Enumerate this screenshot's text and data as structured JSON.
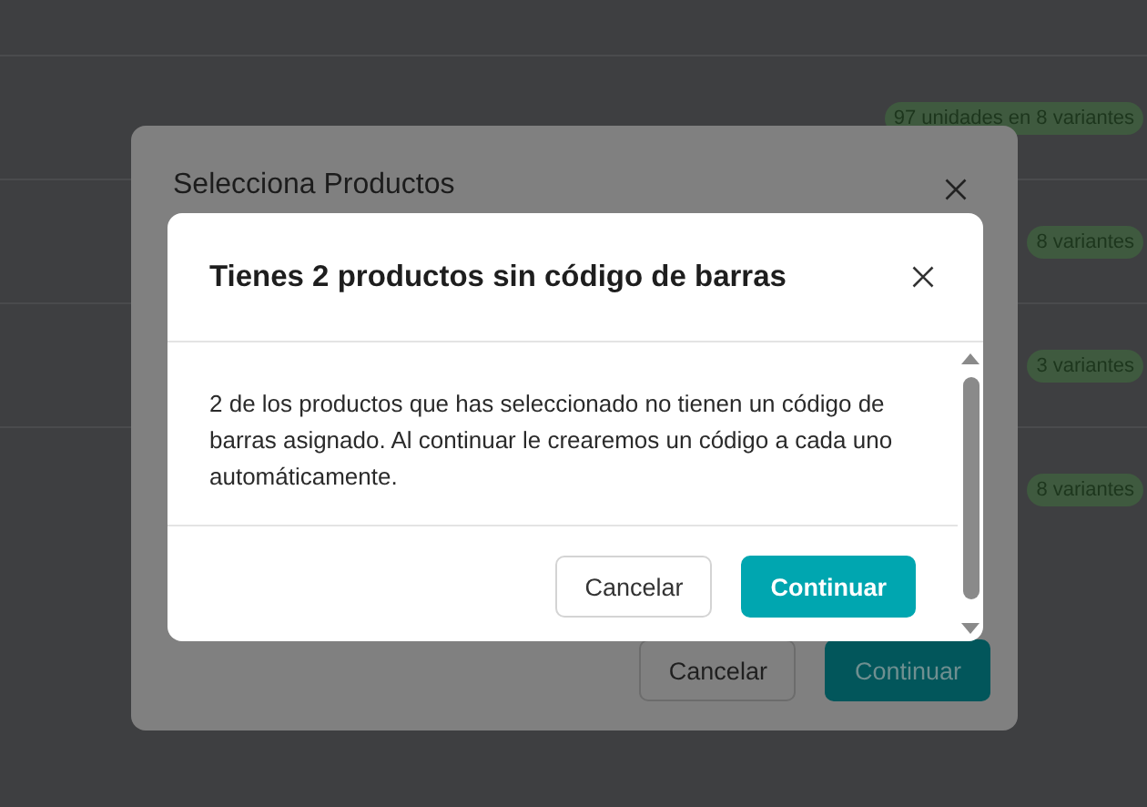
{
  "background_rows": [
    {
      "badge": "97 unidades en 8 variantes"
    },
    {
      "badge": "8 variantes"
    },
    {
      "badge": "3 variantes"
    },
    {
      "badge": "8 variantes"
    }
  ],
  "outer_dialog": {
    "title": "Selecciona Productos",
    "buttons": [
      {
        "label": "Cancelar",
        "kind": "secondary"
      },
      {
        "label": "Continuar",
        "kind": "primary"
      }
    ]
  },
  "dialog": {
    "title": "Tienes 2 productos sin código de barras",
    "message": "2 de los productos que has seleccionado no tienen un código de barras asignado. Al continuar le crearemos un código a cada uno automáticamente.",
    "buttons": [
      {
        "label": "Cancelar",
        "kind": "secondary"
      },
      {
        "label": "Continuar",
        "kind": "primary"
      }
    ]
  }
}
